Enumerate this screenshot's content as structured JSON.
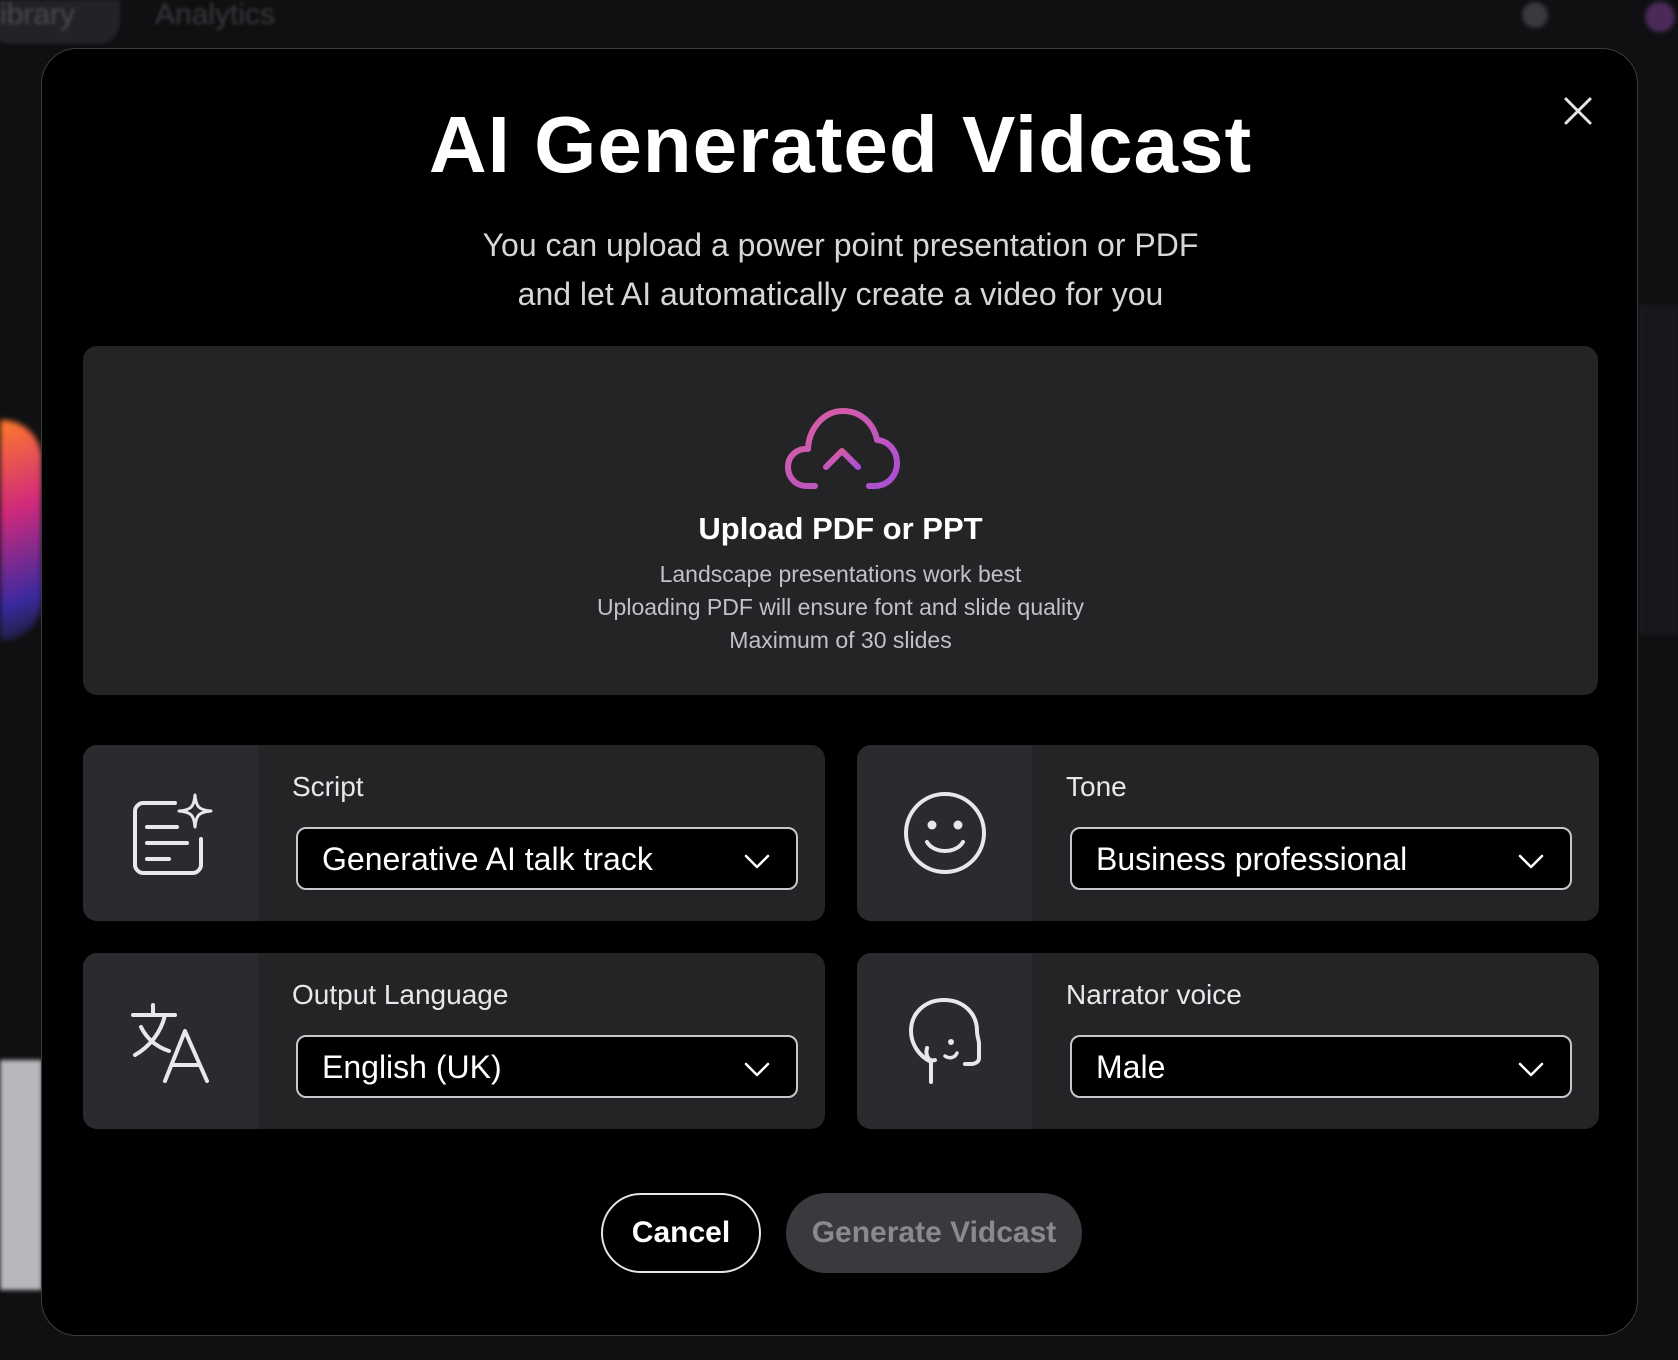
{
  "background": {
    "tab_label": "ibrary",
    "analytics_label": "Analytics"
  },
  "modal": {
    "title": "AI Generated Vidcast",
    "subtitle_line1": "You can upload a power point presentation or PDF",
    "subtitle_line2": "and let AI automatically create a video for you",
    "upload": {
      "title": "Upload PDF or PPT",
      "hints": [
        "Landscape presentations work best",
        "Uploading PDF will ensure font and slide quality",
        "Maximum of 30 slides"
      ]
    },
    "settings": {
      "script": {
        "label": "Script",
        "value": "Generative AI talk track"
      },
      "tone": {
        "label": "Tone",
        "value": "Business professional"
      },
      "language": {
        "label": "Output Language",
        "value": "English (UK)"
      },
      "voice": {
        "label": "Narrator voice",
        "value": "Male"
      }
    },
    "buttons": {
      "cancel": "Cancel",
      "generate": "Generate Vidcast"
    }
  },
  "colors": {
    "modal_bg": "#000000",
    "card_bg": "#242427",
    "accent_gradient_start": "#e0609a",
    "accent_gradient_end": "#a84fd6",
    "disabled_button": "#3a3a3e"
  },
  "icons": {
    "close": "close-icon",
    "upload": "cloud-upload-icon",
    "script": "ai-script-icon",
    "tone": "smiley-icon",
    "language": "translate-icon",
    "voice": "speaking-head-icon",
    "chevron": "chevron-down-icon"
  }
}
